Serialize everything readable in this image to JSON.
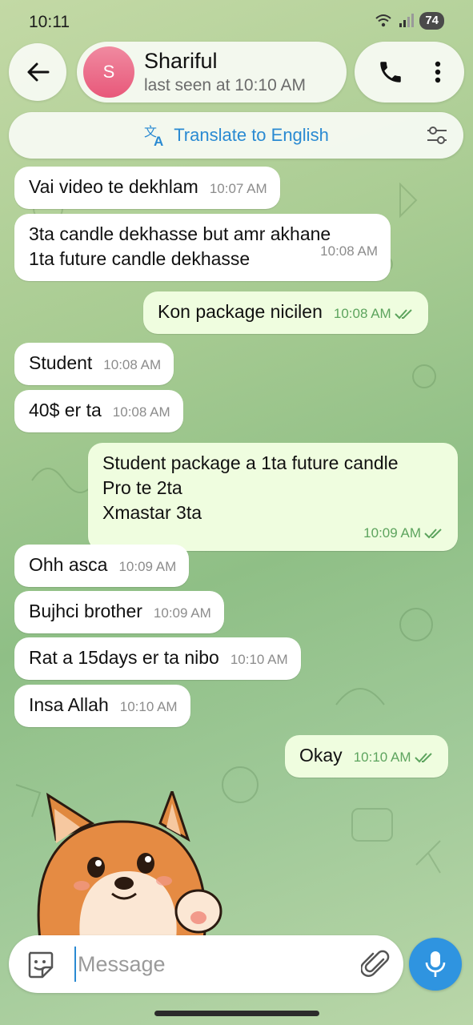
{
  "status_bar": {
    "time": "10:11",
    "battery": "74"
  },
  "header": {
    "avatar_letter": "S",
    "contact_name": "Shariful",
    "contact_status": "last seen at 10:10 AM"
  },
  "translate_bar": {
    "label": "Translate to English"
  },
  "messages": [
    {
      "dir": "in",
      "text": "Vai video te dekhlam",
      "time": "10:07 AM"
    },
    {
      "dir": "in",
      "text": "3ta candle dekhasse but amr akhane\n1ta future candle dekhasse",
      "time": "10:08 AM"
    },
    {
      "dir": "out",
      "text": "Kon package nicilen",
      "time": "10:08 AM",
      "read": true
    },
    {
      "dir": "in",
      "text": "Student",
      "time": "10:08 AM"
    },
    {
      "dir": "in",
      "text": "40$ er ta",
      "time": "10:08 AM"
    },
    {
      "dir": "out",
      "text": "Student package a 1ta future candle\nPro te 2ta\nXmastar  3ta",
      "time": "10:09 AM",
      "read": true
    },
    {
      "dir": "in",
      "text": "Ohh asca",
      "time": "10:09 AM"
    },
    {
      "dir": "in",
      "text": "Bujhci brother",
      "time": "10:09 AM"
    },
    {
      "dir": "in",
      "text": "Rat a 15days er ta nibo",
      "time": "10:10 AM"
    },
    {
      "dir": "in",
      "text": "Insa Allah",
      "time": "10:10 AM"
    },
    {
      "dir": "out",
      "text": "Okay",
      "time": "10:10 AM",
      "read": true
    }
  ],
  "composer": {
    "placeholder": "Message"
  },
  "icons": {
    "back": "arrow-left-icon",
    "call": "phone-icon",
    "menu": "more-vertical-icon",
    "translate": "translate-icon",
    "translate_settings": "sliders-icon",
    "sticker": "sticker-icon",
    "attach": "paperclip-icon",
    "mic": "microphone-icon"
  },
  "colors": {
    "accent": "#2f94e0",
    "outgoing_bubble": "#effddf",
    "read_check": "#5da45e"
  }
}
